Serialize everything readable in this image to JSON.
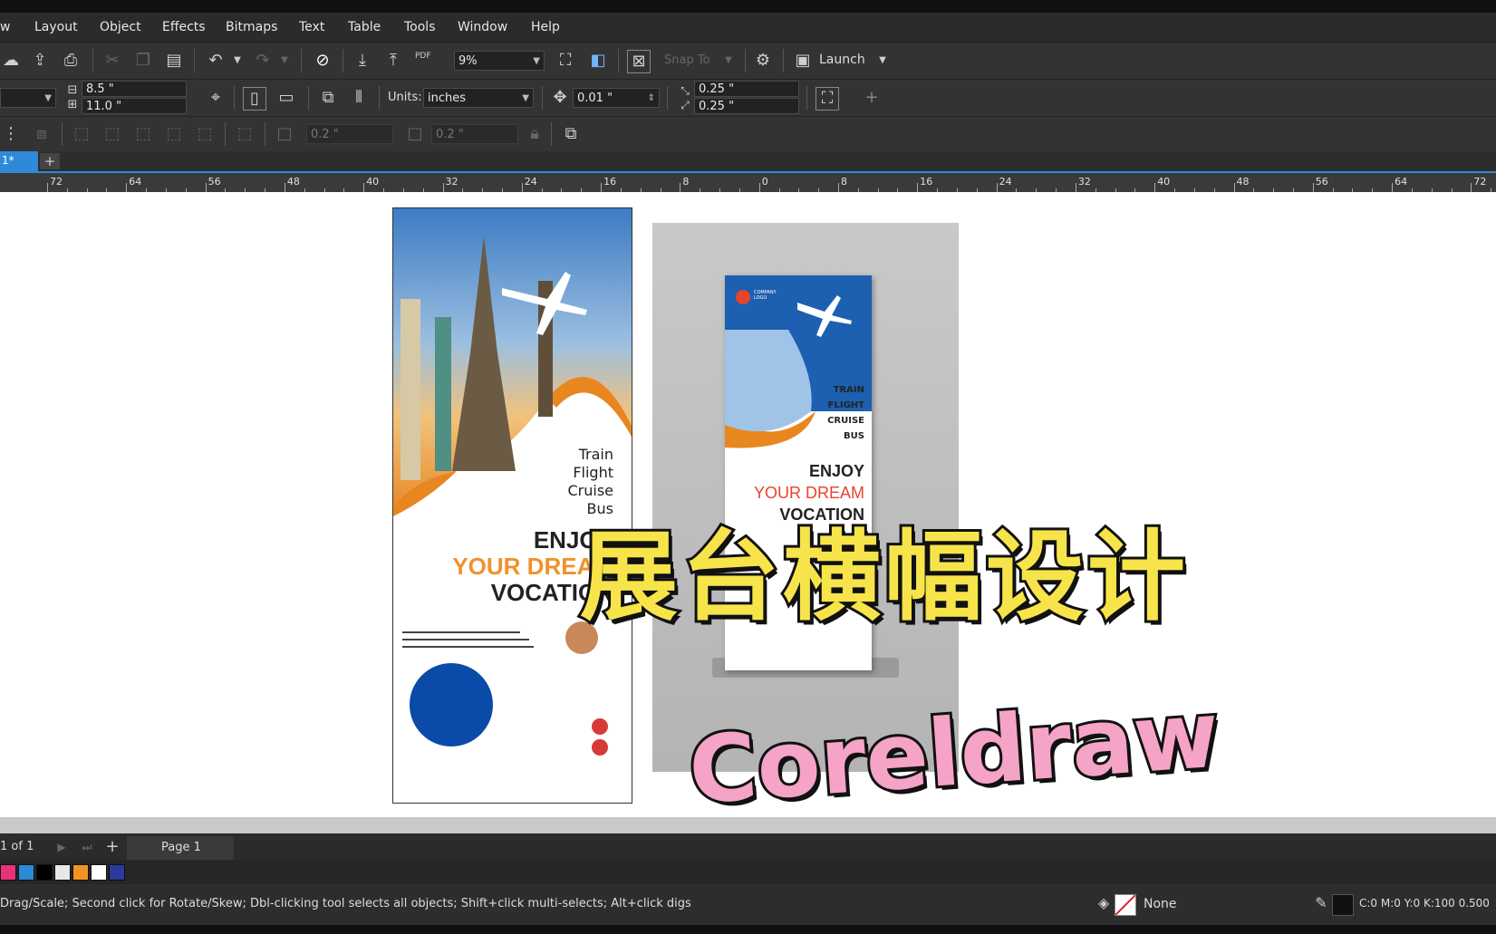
{
  "menu": [
    "w",
    "Layout",
    "Object",
    "Effects",
    "Bitmaps",
    "Text",
    "Table",
    "Tools",
    "Window",
    "Help"
  ],
  "toolbar1": {
    "zoom": "9%",
    "snap_to": "Snap To",
    "launch": "Launch",
    "pdf": "PDF"
  },
  "toolbar2": {
    "width": "8.5 \"",
    "height": "11.0 \"",
    "units_label": "Units:",
    "units_value": "inches",
    "nudge": "0.01 \"",
    "dup_x": "0.25 \"",
    "dup_y": "0.25 \""
  },
  "toolbar3": {
    "field_a": "0.2 \"",
    "field_b": "0.2 \""
  },
  "doc_tab": "1*",
  "ruler_labels": [
    "72",
    "64",
    "56",
    "48",
    "40",
    "32",
    "24",
    "16",
    "8",
    "0",
    "8",
    "16",
    "24",
    "32",
    "40",
    "48",
    "56",
    "64",
    "72"
  ],
  "poster": {
    "services": [
      "Train",
      "Flight",
      "Cruise",
      "Bus"
    ],
    "line1": "ENJOY",
    "line2": "YOUR DREAM",
    "line3": "VOCATION"
  },
  "banner": {
    "services": [
      "TRAIN",
      "FLIGHT",
      "CRUISE",
      "BUS"
    ],
    "line1": "ENJOY",
    "line2": "YOUR DREAM",
    "line3": "VOCATION",
    "logo_text": "COMPANY LOGO"
  },
  "overlay": {
    "title_cn": "展台横幅设计",
    "title_en": "Coreldraw"
  },
  "pagebar": {
    "counter": "1 of 1",
    "page_tab": "Page 1"
  },
  "palette_colors": [
    "#e6327a",
    "#2a8ad6",
    "#000000",
    "#e8e8e8",
    "#f39322",
    "#ffffff",
    "#2b3a9b"
  ],
  "status": {
    "hint": "Drag/Scale; Second click for Rotate/Skew; Dbl-clicking tool selects all objects; Shift+click multi-selects; Alt+click digs",
    "fill": "None",
    "color_readout": "C:0 M:0 Y:0 K:100  0.500"
  }
}
